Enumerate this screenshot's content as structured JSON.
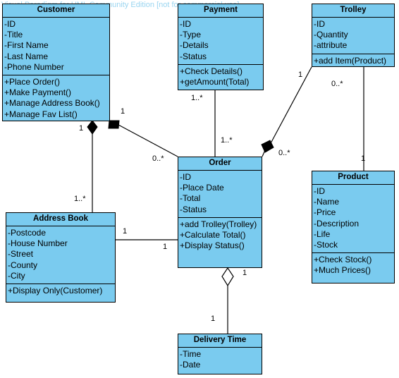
{
  "diagram": {
    "type": "uml-class-diagram",
    "watermark": "Visual Paradigm for UML Community Edition [not for commercial use]",
    "colors": {
      "class_fill": "#7ACBEF",
      "border": "#000000",
      "watermark": "#9AD5F0",
      "background": "#FFFFFF"
    }
  },
  "classes": {
    "customer": {
      "name": "Customer",
      "attributes": [
        "-ID",
        "-Title",
        "-First Name",
        "-Last Name",
        "-Phone Number"
      ],
      "operations": [
        "+Place Order()",
        "+Make Payment()",
        "+Manage Address Book()",
        "+Manage Fav List()"
      ]
    },
    "payment": {
      "name": "Payment",
      "attributes": [
        "-ID",
        "-Type",
        "-Details",
        "-Status"
      ],
      "operations": [
        "+Check Details()",
        "+getAmount(Total)"
      ]
    },
    "trolley": {
      "name": "Trolley",
      "attributes": [
        "-ID",
        "-Quantity",
        "-attribute"
      ],
      "operations": [
        "+add Item(Product)"
      ]
    },
    "order": {
      "name": "Order",
      "attributes": [
        "-ID",
        "-Place Date",
        "-Total",
        "-Status"
      ],
      "operations": [
        "+add Trolley(Trolley)",
        "+Calculate Total()",
        "+Display Status()"
      ]
    },
    "product": {
      "name": "Product",
      "attributes": [
        "-ID",
        "-Name",
        "-Price",
        "-Description",
        "-Life",
        "-Stock"
      ],
      "operations": [
        "+Check Stock()",
        "+Much Prices()"
      ]
    },
    "address_book": {
      "name": "Address Book",
      "attributes": [
        "-Postcode",
        "-House Number",
        "-Street",
        "-County",
        "-City"
      ],
      "operations": [
        "+Display Only(Customer)"
      ]
    },
    "delivery_time": {
      "name": "Delivery Time",
      "attributes": [
        "-Time",
        "-Date"
      ],
      "operations": []
    }
  },
  "relationships": [
    {
      "id": "customer-address-book",
      "from": "customer",
      "to": "address_book",
      "kind": "composition",
      "diamond_at": "customer",
      "from_multiplicity": "1",
      "to_multiplicity": "1..*"
    },
    {
      "id": "customer-order",
      "from": "customer",
      "to": "order",
      "kind": "composition",
      "diamond_at": "customer",
      "from_multiplicity": "1",
      "to_multiplicity": "0..*"
    },
    {
      "id": "payment-order",
      "from": "payment",
      "to": "order",
      "kind": "association",
      "from_multiplicity": "1..*",
      "to_multiplicity": "1..*"
    },
    {
      "id": "trolley-order",
      "from": "trolley",
      "to": "order",
      "kind": "composition",
      "diamond_at": "order",
      "from_multiplicity": "1",
      "to_multiplicity": "0..*"
    },
    {
      "id": "trolley-product",
      "from": "trolley",
      "to": "product",
      "kind": "association",
      "from_multiplicity": "0..*",
      "to_multiplicity": "1"
    },
    {
      "id": "address-book-order",
      "from": "address_book",
      "to": "order",
      "kind": "association",
      "from_multiplicity": "1",
      "to_multiplicity": "1"
    },
    {
      "id": "order-delivery-time",
      "from": "order",
      "to": "delivery_time",
      "kind": "aggregation",
      "diamond_at": "order",
      "from_multiplicity": "1",
      "to_multiplicity": "1"
    }
  ],
  "multiplicity_labels": {
    "customer_order_near": "1",
    "customer_order_far": "0..*",
    "customer_addrbook_near": "1",
    "customer_addrbook_far": "1..*",
    "payment_near": "1..*",
    "payment_far": "1..*",
    "trolley_order_near": "1",
    "trolley_order_far": "0..*",
    "trolley_product_near": "0..*",
    "trolley_product_far": "1",
    "addrbook_order_near": "1",
    "addrbook_order_far": "1",
    "order_delivery_near": "1",
    "order_delivery_far": "1"
  }
}
